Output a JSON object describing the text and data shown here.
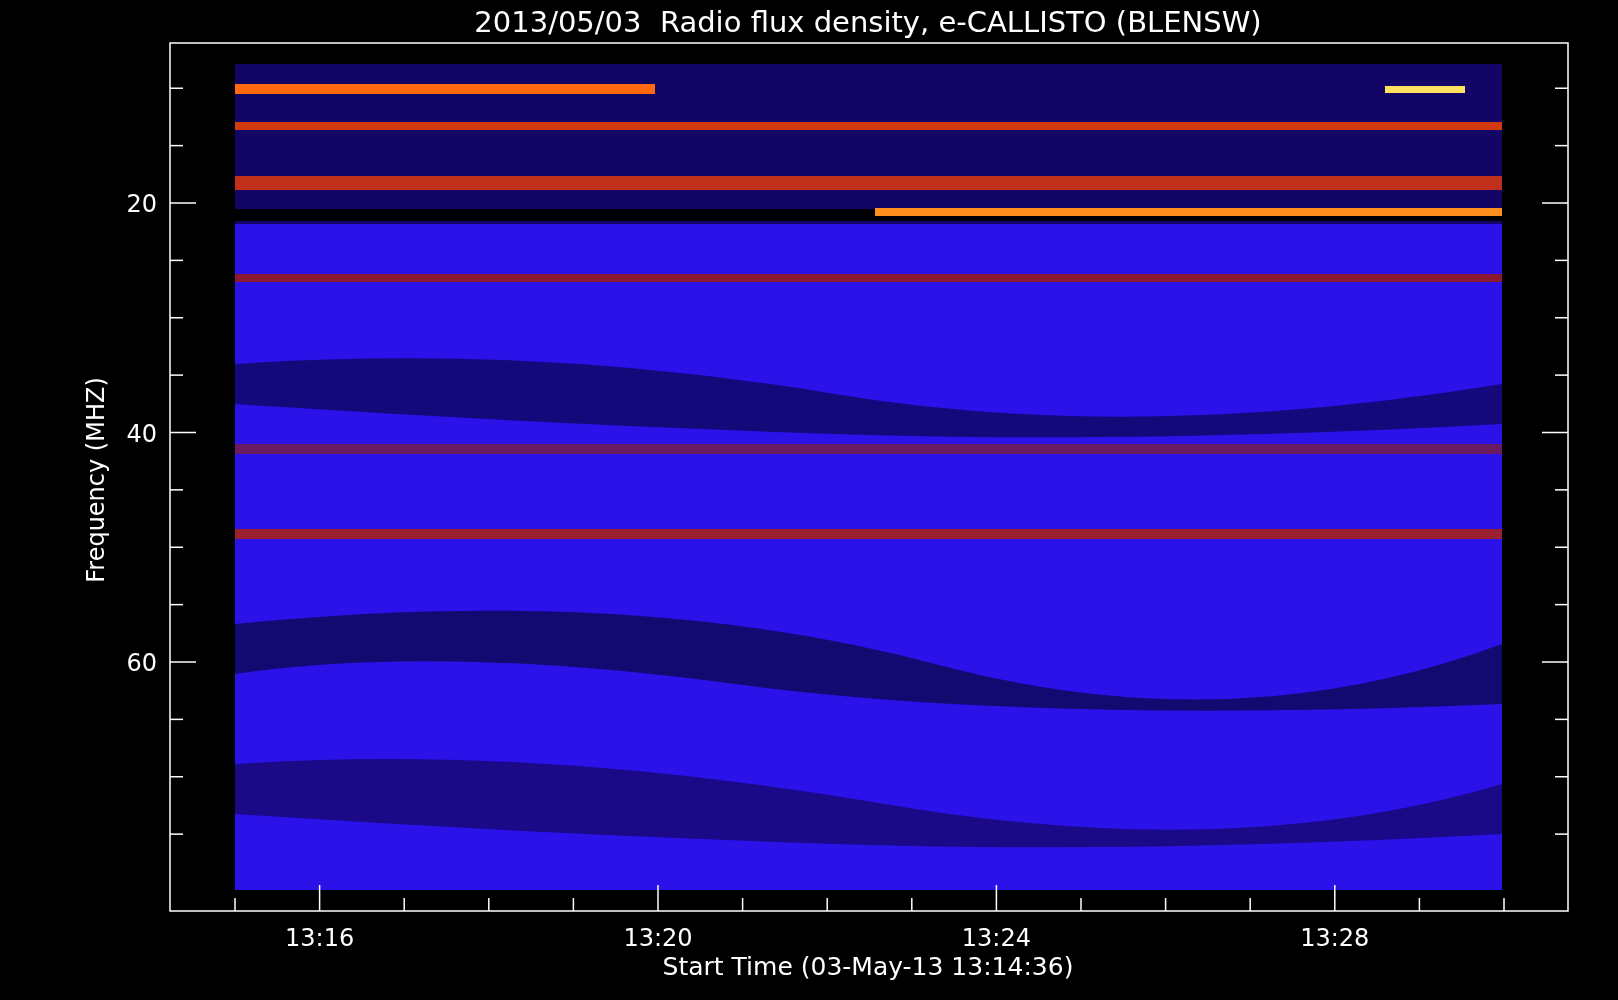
{
  "plot": {
    "title": "2013/05/03  Radio flux density, e-CALLISTO (BLENSW)",
    "xlabel": "Start Time (03-May-13 13:14:36)",
    "ylabel": "Frequency (MHZ)",
    "xticks": [
      "13:16",
      "13:20",
      "13:24",
      "13:28"
    ],
    "yticks": [
      "20",
      "40",
      "60"
    ]
  }
}
